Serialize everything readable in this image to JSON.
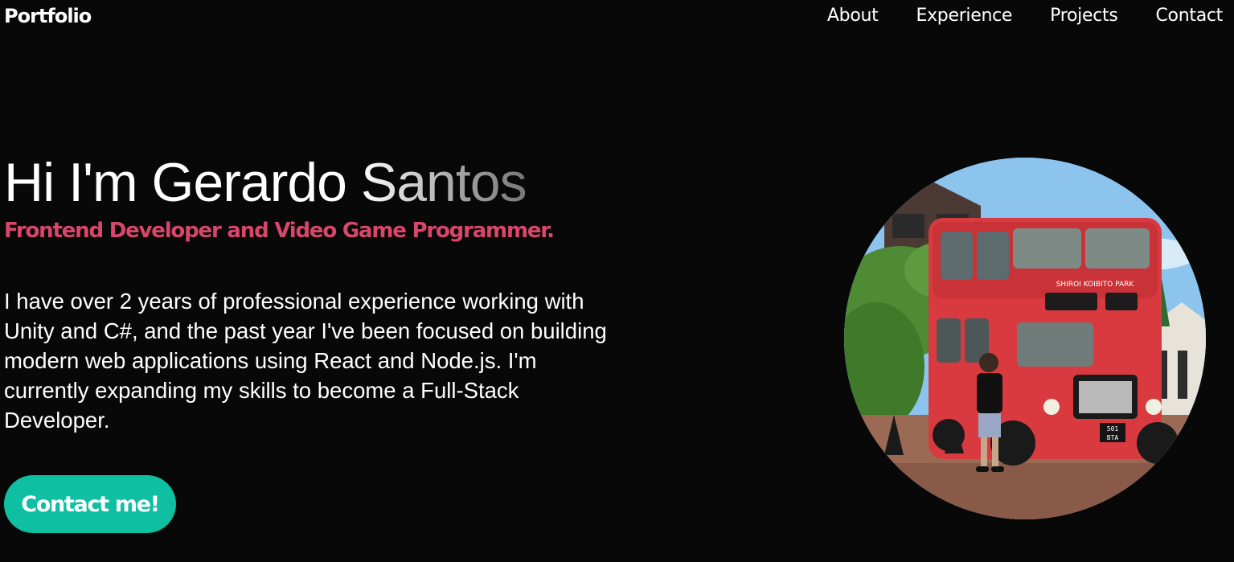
{
  "nav": {
    "brand": "Portfolio",
    "links": [
      {
        "label": "About"
      },
      {
        "label": "Experience"
      },
      {
        "label": "Projects"
      },
      {
        "label": "Contact"
      }
    ]
  },
  "hero": {
    "title": "Hi I'm Gerardo Santos",
    "subtitle": "Frontend Developer and Video Game Programmer.",
    "description": "I have over 2 years of professional experience working with Unity and C#, and the past year I've been focused on building modern web applications using React and Node.js. I'm currently expanding my skills to become a Full-Stack Developer.",
    "cta_label": "Contact me!"
  },
  "photo": {
    "bus_sign": "SHIROI KOIBITO PARK",
    "plate_top": "501",
    "plate_bottom": "BTA"
  },
  "colors": {
    "background": "#080808",
    "accent_pink": "#d9466b",
    "accent_teal": "#0ebfa2"
  }
}
